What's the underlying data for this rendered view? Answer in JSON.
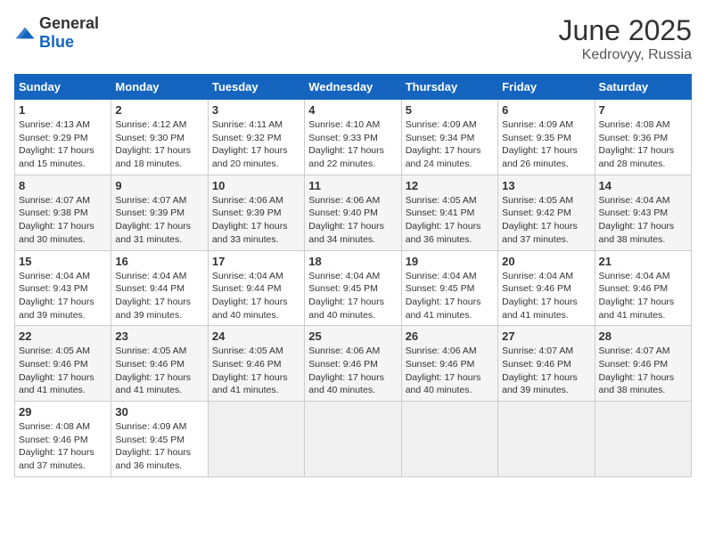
{
  "header": {
    "logo_general": "General",
    "logo_blue": "Blue",
    "month": "June 2025",
    "location": "Kedrovyy, Russia"
  },
  "days_of_week": [
    "Sunday",
    "Monday",
    "Tuesday",
    "Wednesday",
    "Thursday",
    "Friday",
    "Saturday"
  ],
  "weeks": [
    [
      {
        "day": "1",
        "sunrise": "4:13 AM",
        "sunset": "9:29 PM",
        "daylight": "17 hours and 15 minutes."
      },
      {
        "day": "2",
        "sunrise": "4:12 AM",
        "sunset": "9:30 PM",
        "daylight": "17 hours and 18 minutes."
      },
      {
        "day": "3",
        "sunrise": "4:11 AM",
        "sunset": "9:32 PM",
        "daylight": "17 hours and 20 minutes."
      },
      {
        "day": "4",
        "sunrise": "4:10 AM",
        "sunset": "9:33 PM",
        "daylight": "17 hours and 22 minutes."
      },
      {
        "day": "5",
        "sunrise": "4:09 AM",
        "sunset": "9:34 PM",
        "daylight": "17 hours and 24 minutes."
      },
      {
        "day": "6",
        "sunrise": "4:09 AM",
        "sunset": "9:35 PM",
        "daylight": "17 hours and 26 minutes."
      },
      {
        "day": "7",
        "sunrise": "4:08 AM",
        "sunset": "9:36 PM",
        "daylight": "17 hours and 28 minutes."
      }
    ],
    [
      {
        "day": "8",
        "sunrise": "4:07 AM",
        "sunset": "9:38 PM",
        "daylight": "17 hours and 30 minutes."
      },
      {
        "day": "9",
        "sunrise": "4:07 AM",
        "sunset": "9:39 PM",
        "daylight": "17 hours and 31 minutes."
      },
      {
        "day": "10",
        "sunrise": "4:06 AM",
        "sunset": "9:39 PM",
        "daylight": "17 hours and 33 minutes."
      },
      {
        "day": "11",
        "sunrise": "4:06 AM",
        "sunset": "9:40 PM",
        "daylight": "17 hours and 34 minutes."
      },
      {
        "day": "12",
        "sunrise": "4:05 AM",
        "sunset": "9:41 PM",
        "daylight": "17 hours and 36 minutes."
      },
      {
        "day": "13",
        "sunrise": "4:05 AM",
        "sunset": "9:42 PM",
        "daylight": "17 hours and 37 minutes."
      },
      {
        "day": "14",
        "sunrise": "4:04 AM",
        "sunset": "9:43 PM",
        "daylight": "17 hours and 38 minutes."
      }
    ],
    [
      {
        "day": "15",
        "sunrise": "4:04 AM",
        "sunset": "9:43 PM",
        "daylight": "17 hours and 39 minutes."
      },
      {
        "day": "16",
        "sunrise": "4:04 AM",
        "sunset": "9:44 PM",
        "daylight": "17 hours and 39 minutes."
      },
      {
        "day": "17",
        "sunrise": "4:04 AM",
        "sunset": "9:44 PM",
        "daylight": "17 hours and 40 minutes."
      },
      {
        "day": "18",
        "sunrise": "4:04 AM",
        "sunset": "9:45 PM",
        "daylight": "17 hours and 40 minutes."
      },
      {
        "day": "19",
        "sunrise": "4:04 AM",
        "sunset": "9:45 PM",
        "daylight": "17 hours and 41 minutes."
      },
      {
        "day": "20",
        "sunrise": "4:04 AM",
        "sunset": "9:46 PM",
        "daylight": "17 hours and 41 minutes."
      },
      {
        "day": "21",
        "sunrise": "4:04 AM",
        "sunset": "9:46 PM",
        "daylight": "17 hours and 41 minutes."
      }
    ],
    [
      {
        "day": "22",
        "sunrise": "4:05 AM",
        "sunset": "9:46 PM",
        "daylight": "17 hours and 41 minutes."
      },
      {
        "day": "23",
        "sunrise": "4:05 AM",
        "sunset": "9:46 PM",
        "daylight": "17 hours and 41 minutes."
      },
      {
        "day": "24",
        "sunrise": "4:05 AM",
        "sunset": "9:46 PM",
        "daylight": "17 hours and 41 minutes."
      },
      {
        "day": "25",
        "sunrise": "4:06 AM",
        "sunset": "9:46 PM",
        "daylight": "17 hours and 40 minutes."
      },
      {
        "day": "26",
        "sunrise": "4:06 AM",
        "sunset": "9:46 PM",
        "daylight": "17 hours and 40 minutes."
      },
      {
        "day": "27",
        "sunrise": "4:07 AM",
        "sunset": "9:46 PM",
        "daylight": "17 hours and 39 minutes."
      },
      {
        "day": "28",
        "sunrise": "4:07 AM",
        "sunset": "9:46 PM",
        "daylight": "17 hours and 38 minutes."
      }
    ],
    [
      {
        "day": "29",
        "sunrise": "4:08 AM",
        "sunset": "9:46 PM",
        "daylight": "17 hours and 37 minutes."
      },
      {
        "day": "30",
        "sunrise": "4:09 AM",
        "sunset": "9:45 PM",
        "daylight": "17 hours and 36 minutes."
      },
      null,
      null,
      null,
      null,
      null
    ]
  ]
}
